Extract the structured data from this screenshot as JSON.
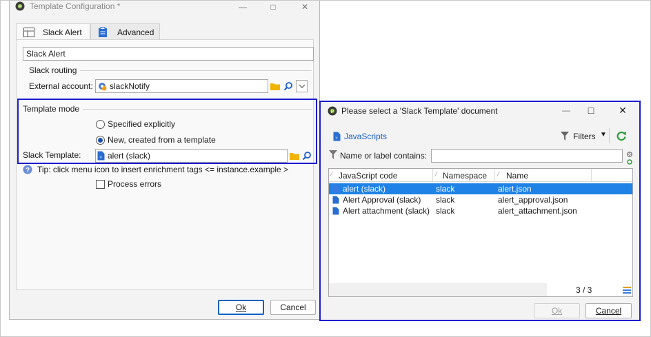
{
  "main_dialog": {
    "title": "Template Configuration *",
    "tabs": [
      {
        "label": "Slack Alert",
        "icon": "layout-form-icon",
        "active": true
      },
      {
        "label": "Advanced",
        "icon": "clipboard-icon",
        "active": false
      }
    ],
    "label_value": "Slack Alert",
    "routing": {
      "group_label": "Slack routing",
      "external_account_label": "External account:",
      "external_account_value": "slackNotify"
    },
    "template_mode": {
      "group_label": "Template mode",
      "options": [
        "Specified explicitly",
        "New, created from a template"
      ],
      "selected_index": 1,
      "slack_template_label": "Slack Template:",
      "slack_template_value": "alert (slack)"
    },
    "tip_text": "Tip: click menu icon to insert enrichment tags <= instance.example >",
    "process_errors_label": "Process errors",
    "process_errors_checked": false,
    "ok_label": "Ok",
    "cancel_label": "Cancel"
  },
  "select_dialog": {
    "title": "Please select a 'Slack Template' document",
    "folder_label": "JavaScripts",
    "filters_label": "Filters",
    "filter_field_label": "Name or label contains:",
    "filter_value": "",
    "columns": [
      "JavaScript code",
      "Namespace",
      "Name"
    ],
    "rows": [
      {
        "code": "alert (slack)",
        "namespace": "slack",
        "name": "alert.json",
        "selected": true
      },
      {
        "code": "Alert Approval (slack)",
        "namespace": "slack",
        "name": "alert_approval.json",
        "selected": false
      },
      {
        "code": "Alert attachment (slack)",
        "namespace": "slack",
        "name": "alert_attachment.json",
        "selected": false
      }
    ],
    "count": "3 / 3",
    "ok_label": "Ok",
    "cancel_label": "Cancel"
  },
  "colors": {
    "highlight": "#1a1ad0",
    "selection": "#1e82e6",
    "accent_blue": "#1a4fb0",
    "folder_yellow": "#f0b400",
    "refresh_green": "#2e9b3a"
  }
}
